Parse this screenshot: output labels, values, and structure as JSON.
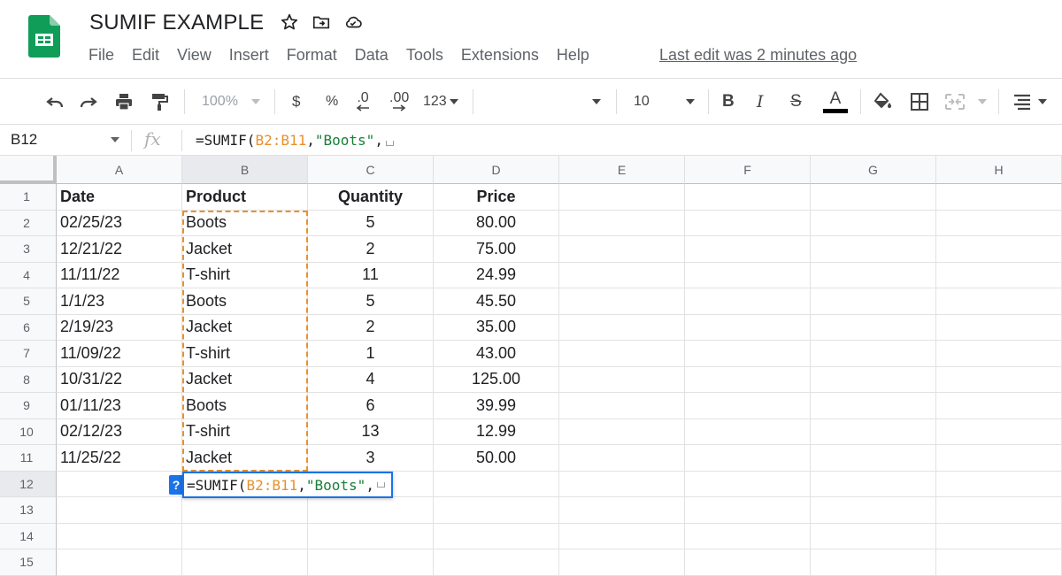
{
  "doc": {
    "title": "SUMIF EXAMPLE",
    "last_edit": "Last edit was 2 minutes ago"
  },
  "menu": [
    "File",
    "Edit",
    "View",
    "Insert",
    "Format",
    "Data",
    "Tools",
    "Extensions",
    "Help"
  ],
  "toolbar": {
    "zoom": "100%",
    "currency": "$",
    "percent": "%",
    "decrease_decimal": ".0",
    "increase_decimal": ".00",
    "more_formats": "123",
    "font_size": "10",
    "bold": "B",
    "italic": "I",
    "strike": "S",
    "text_color": "A"
  },
  "formula_bar": {
    "cell_ref": "B12",
    "fx": "fx",
    "prefix": "=SUMIF(",
    "range": "B2:B11",
    "sep1": ",",
    "criterion": "\"Boots\"",
    "sep2": ","
  },
  "columns": [
    "A",
    "B",
    "C",
    "D",
    "E",
    "F",
    "G",
    "H"
  ],
  "rows": [
    [
      "Date",
      "Product",
      "Quantity",
      "Price"
    ],
    [
      "02/25/23",
      "Boots",
      "5",
      "80.00"
    ],
    [
      "12/21/22",
      "Jacket",
      "2",
      "75.00"
    ],
    [
      "11/11/22",
      "T-shirt",
      "11",
      "24.99"
    ],
    [
      "1/1/23",
      "Boots",
      "5",
      "45.50"
    ],
    [
      "2/19/23",
      "Jacket",
      "2",
      "35.00"
    ],
    [
      "11/09/22",
      "T-shirt",
      "1",
      "43.00"
    ],
    [
      "10/31/22",
      "Jacket",
      "4",
      "125.00"
    ],
    [
      "01/11/23",
      "Boots",
      "6",
      "39.99"
    ],
    [
      "02/12/23",
      "T-shirt",
      "13",
      "12.99"
    ],
    [
      "11/25/22",
      "Jacket",
      "3",
      "50.00"
    ],
    [
      "",
      "",
      "",
      ""
    ],
    [
      "",
      "",
      "",
      ""
    ],
    [
      "",
      "",
      "",
      ""
    ],
    [
      "",
      "",
      "",
      ""
    ]
  ],
  "row_numbers": [
    "1",
    "2",
    "3",
    "4",
    "5",
    "6",
    "7",
    "8",
    "9",
    "10",
    "11",
    "12",
    "13",
    "14",
    "15"
  ],
  "editor": {
    "help": "?"
  },
  "colors": {
    "accent": "#1a73e8",
    "range_highlight": "#e8912d",
    "string_literal": "#188038",
    "sheets_green": "#0f9d58"
  }
}
